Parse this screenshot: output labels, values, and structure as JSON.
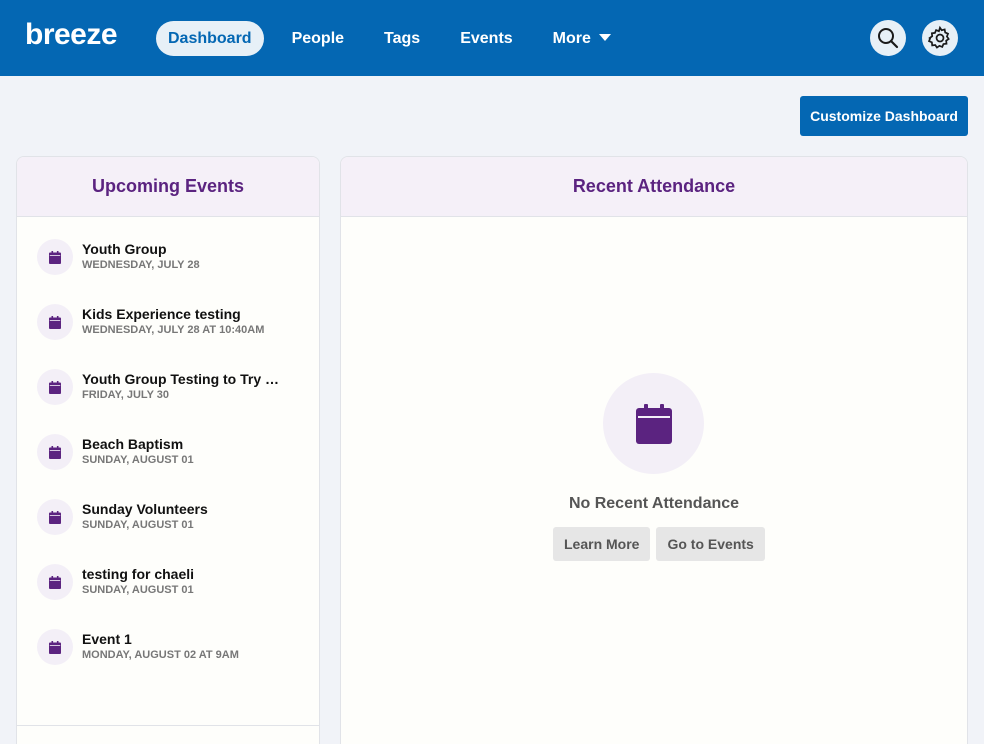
{
  "brand": {
    "logo_text": "breeze",
    "primary_color": "#0467b3",
    "accent_color": "#5b2380"
  },
  "nav": {
    "items": [
      {
        "label": "Dashboard",
        "active": true
      },
      {
        "label": "People"
      },
      {
        "label": "Tags"
      },
      {
        "label": "Events"
      },
      {
        "label": "More"
      }
    ],
    "search_icon": "search-icon",
    "settings_icon": "gear-icon"
  },
  "toolbar": {
    "customize_label": "Customize Dashboard"
  },
  "upcoming": {
    "title": "Upcoming Events",
    "events": [
      {
        "name": "Youth Group",
        "date": "WEDNESDAY, JULY 28"
      },
      {
        "name": "Kids Experience testing",
        "date": "WEDNESDAY, JULY 28 AT 10:40AM"
      },
      {
        "name": "Youth Group Testing to Try a…",
        "date": "FRIDAY, JULY 30"
      },
      {
        "name": "Beach Baptism",
        "date": "SUNDAY, AUGUST 01"
      },
      {
        "name": "Sunday Volunteers",
        "date": "SUNDAY, AUGUST 01"
      },
      {
        "name": "testing for chaeli",
        "date": "SUNDAY, AUGUST 01"
      },
      {
        "name": "Event 1",
        "date": "MONDAY, AUGUST 02 AT 9AM"
      }
    ]
  },
  "attendance": {
    "title": "Recent Attendance",
    "empty_title": "No Recent Attendance",
    "learn_more": "Learn More",
    "go_to_events": "Go to Events"
  }
}
